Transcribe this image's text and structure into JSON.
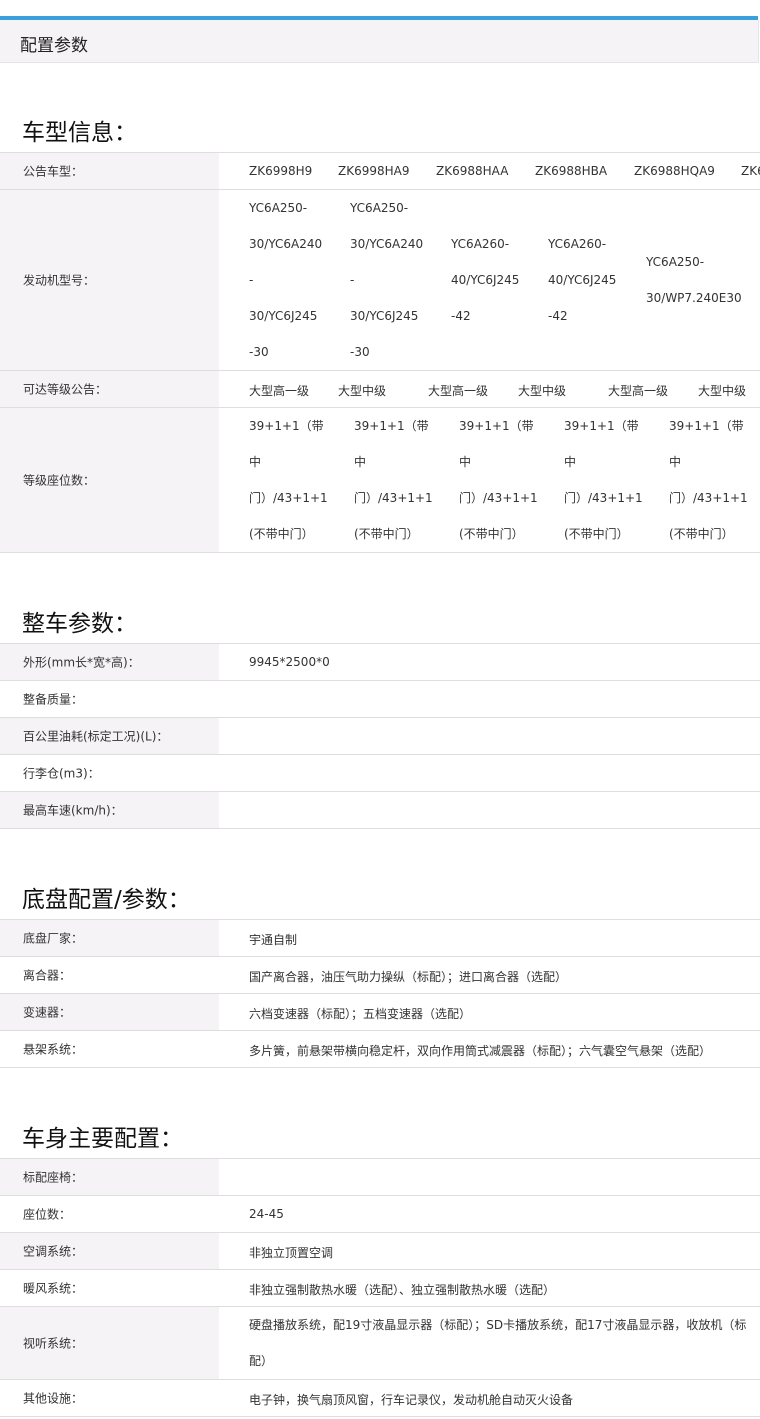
{
  "tab": {
    "title": "配置参数"
  },
  "sections": {
    "vehicle_info": "车型信息：",
    "whole_vehicle": "整车参数：",
    "chassis": "底盘配置/参数：",
    "body": "车身主要配置："
  },
  "vehicle_info": {
    "labels": [
      "公告车型：",
      "发动机型号：",
      "可达等级公告：",
      "等级座位数："
    ],
    "models": [
      "ZK6998H9",
      "ZK6998HA9",
      "ZK6988HAA",
      "ZK6988HBA",
      "ZK6988HQA9",
      "ZK6"
    ],
    "engines": [
      [
        "YC6A250-",
        "30/YC6A240",
        "-",
        "30/YC6J245",
        "-30"
      ],
      [
        "YC6A250-",
        "30/YC6A240",
        "-",
        "30/YC6J245",
        "-30"
      ],
      [
        "YC6A260-",
        "40/YC6J245",
        "-42"
      ],
      [
        "YC6A260-",
        "40/YC6J245",
        "-42"
      ],
      [
        "YC6A250-",
        "30/WP7.240E30"
      ]
    ],
    "grades": [
      "大型高一级",
      "大型中级",
      "大型高一级",
      "大型中级",
      "大型高一级",
      "大型中级"
    ],
    "seats": [
      [
        "39+1+1（带",
        "中",
        "门）/43+1+1",
        "(不带中门）"
      ],
      [
        "39+1+1（带",
        "中",
        "门）/43+1+1",
        "(不带中门）"
      ],
      [
        "39+1+1（带",
        "中",
        "门）/43+1+1",
        "(不带中门）"
      ],
      [
        "39+1+1（带",
        "中",
        "门）/43+1+1",
        "(不带中门）"
      ],
      [
        "39+1+1（带",
        "中",
        "门）/43+1+1",
        "(不带中门）"
      ]
    ]
  },
  "whole_vehicle": {
    "rows": [
      {
        "label": "外形(mm长*宽*高)：",
        "value": "9945*2500*0"
      },
      {
        "label": "整备质量：",
        "value": ""
      },
      {
        "label": "百公里油耗(标定工况)(L)：",
        "value": ""
      },
      {
        "label": "行李仓(m3)：",
        "value": ""
      },
      {
        "label": "最高车速(km/h)：",
        "value": ""
      }
    ]
  },
  "chassis": {
    "rows": [
      {
        "label": "底盘厂家：",
        "value": "宇通自制"
      },
      {
        "label": "离合器：",
        "value": "国产离合器，油压气助力操纵（标配）；进口离合器（选配）"
      },
      {
        "label": "变速器：",
        "value": "六档变速器（标配）；五档变速器（选配）"
      },
      {
        "label": "悬架系统：",
        "value": "多片簧，前悬架带横向稳定杆，双向作用筒式减震器（标配）；六气囊空气悬架（选配）"
      }
    ]
  },
  "body": {
    "rows": [
      {
        "label": "标配座椅：",
        "value": ""
      },
      {
        "label": "座位数：",
        "value": "24-45"
      },
      {
        "label": "空调系统：",
        "value": "非独立顶置空调"
      },
      {
        "label": "暖风系统：",
        "value": "非独立强制散热水暖（选配）、独立强制散热水暖（选配）"
      },
      {
        "label": "视听系统：",
        "value": "硬盘播放系统，配19寸液晶显示器（标配）；SD卡播放系统，配17寸液晶显示器，收放机（标配）"
      },
      {
        "label": "其他设施：",
        "value": "电子钟，换气扇顶风窗，行车记录仪，发动机舱自动灭火设备"
      }
    ]
  }
}
